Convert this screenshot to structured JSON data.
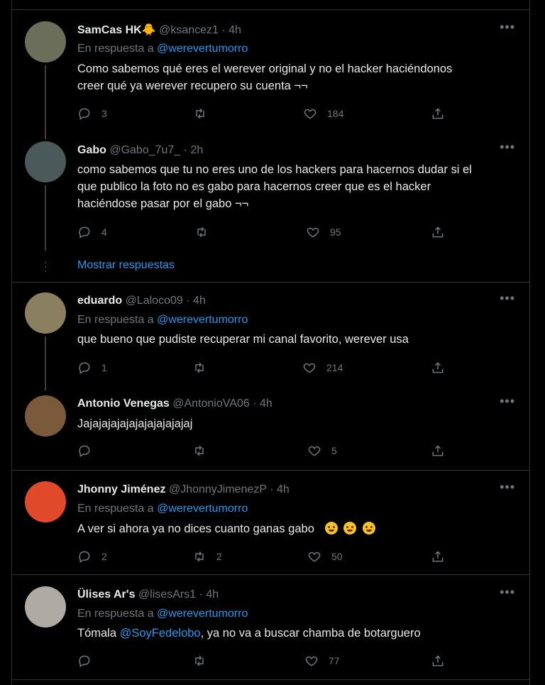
{
  "tweets": [
    {
      "name": "SamCas HK🐥",
      "handle": "@ksancez1",
      "time": "· 4h",
      "reply_prefix": "En respuesta a",
      "reply_to": "@werevertumorro",
      "text_lines": [
        "Como sabemos qué eres el werever original y no el hacker haciéndonos",
        "creer qué ya werever recupero su cuenta ¬¬"
      ],
      "replies": "3",
      "retweets": "",
      "likes": "184",
      "avatar_color": "#6b6f5a"
    },
    {
      "name": "Gabo",
      "handle": "@Gabo_7u7_",
      "time": "· 2h",
      "text_lines": [
        "como sabemos que tu no eres uno de los hackers para hacernos dudar si el",
        "que publico la foto no es gabo para hacernos creer que es el hacker",
        "haciéndose pasar por el gabo ¬¬"
      ],
      "replies": "4",
      "retweets": "",
      "likes": "95",
      "avatar_color": "#4a5a5a"
    },
    {
      "name": "eduardo",
      "handle": "@Laloco09",
      "time": "· 4h",
      "reply_prefix": "En respuesta a",
      "reply_to": "@werevertumorro",
      "text_lines": [
        "que bueno que pudiste recuperar mi canal favorito, werever usa"
      ],
      "replies": "1",
      "retweets": "",
      "likes": "214",
      "avatar_color": "#8a8060"
    },
    {
      "name": "Antonio Venegas",
      "handle": "@AntonioVA06",
      "time": "· 4h",
      "text_lines": [
        "Jajajajajajajajajajajajaj"
      ],
      "replies": "",
      "retweets": "",
      "likes": "5",
      "avatar_color": "#7a5a3a"
    },
    {
      "name": "Jhonny Jiménez",
      "handle": "@JhonnyJimenezP",
      "time": "· 4h",
      "reply_prefix": "En respuesta a",
      "reply_to": "@werevertumorro",
      "text_lines": [
        "A ver si ahora ya no dices cuanto ganas gabo"
      ],
      "replies": "2",
      "retweets": "2",
      "likes": "50",
      "avatar_color": "#e04a2a"
    },
    {
      "name": "Ülises Ar's",
      "handle": "@lisesArs1",
      "time": "· 4h",
      "reply_prefix": "En respuesta a",
      "reply_to": "@werevertumorro",
      "text_before": "Tómala ",
      "text_mention": "@SoyFedelobo",
      "text_after": ", ya no va a buscar chamba de botarguero",
      "replies": "",
      "retweets": "",
      "likes": "77",
      "avatar_color": "#b0aaa5"
    }
  ],
  "show_replies_label": "Mostrar respuestas",
  "more_label": "•••"
}
